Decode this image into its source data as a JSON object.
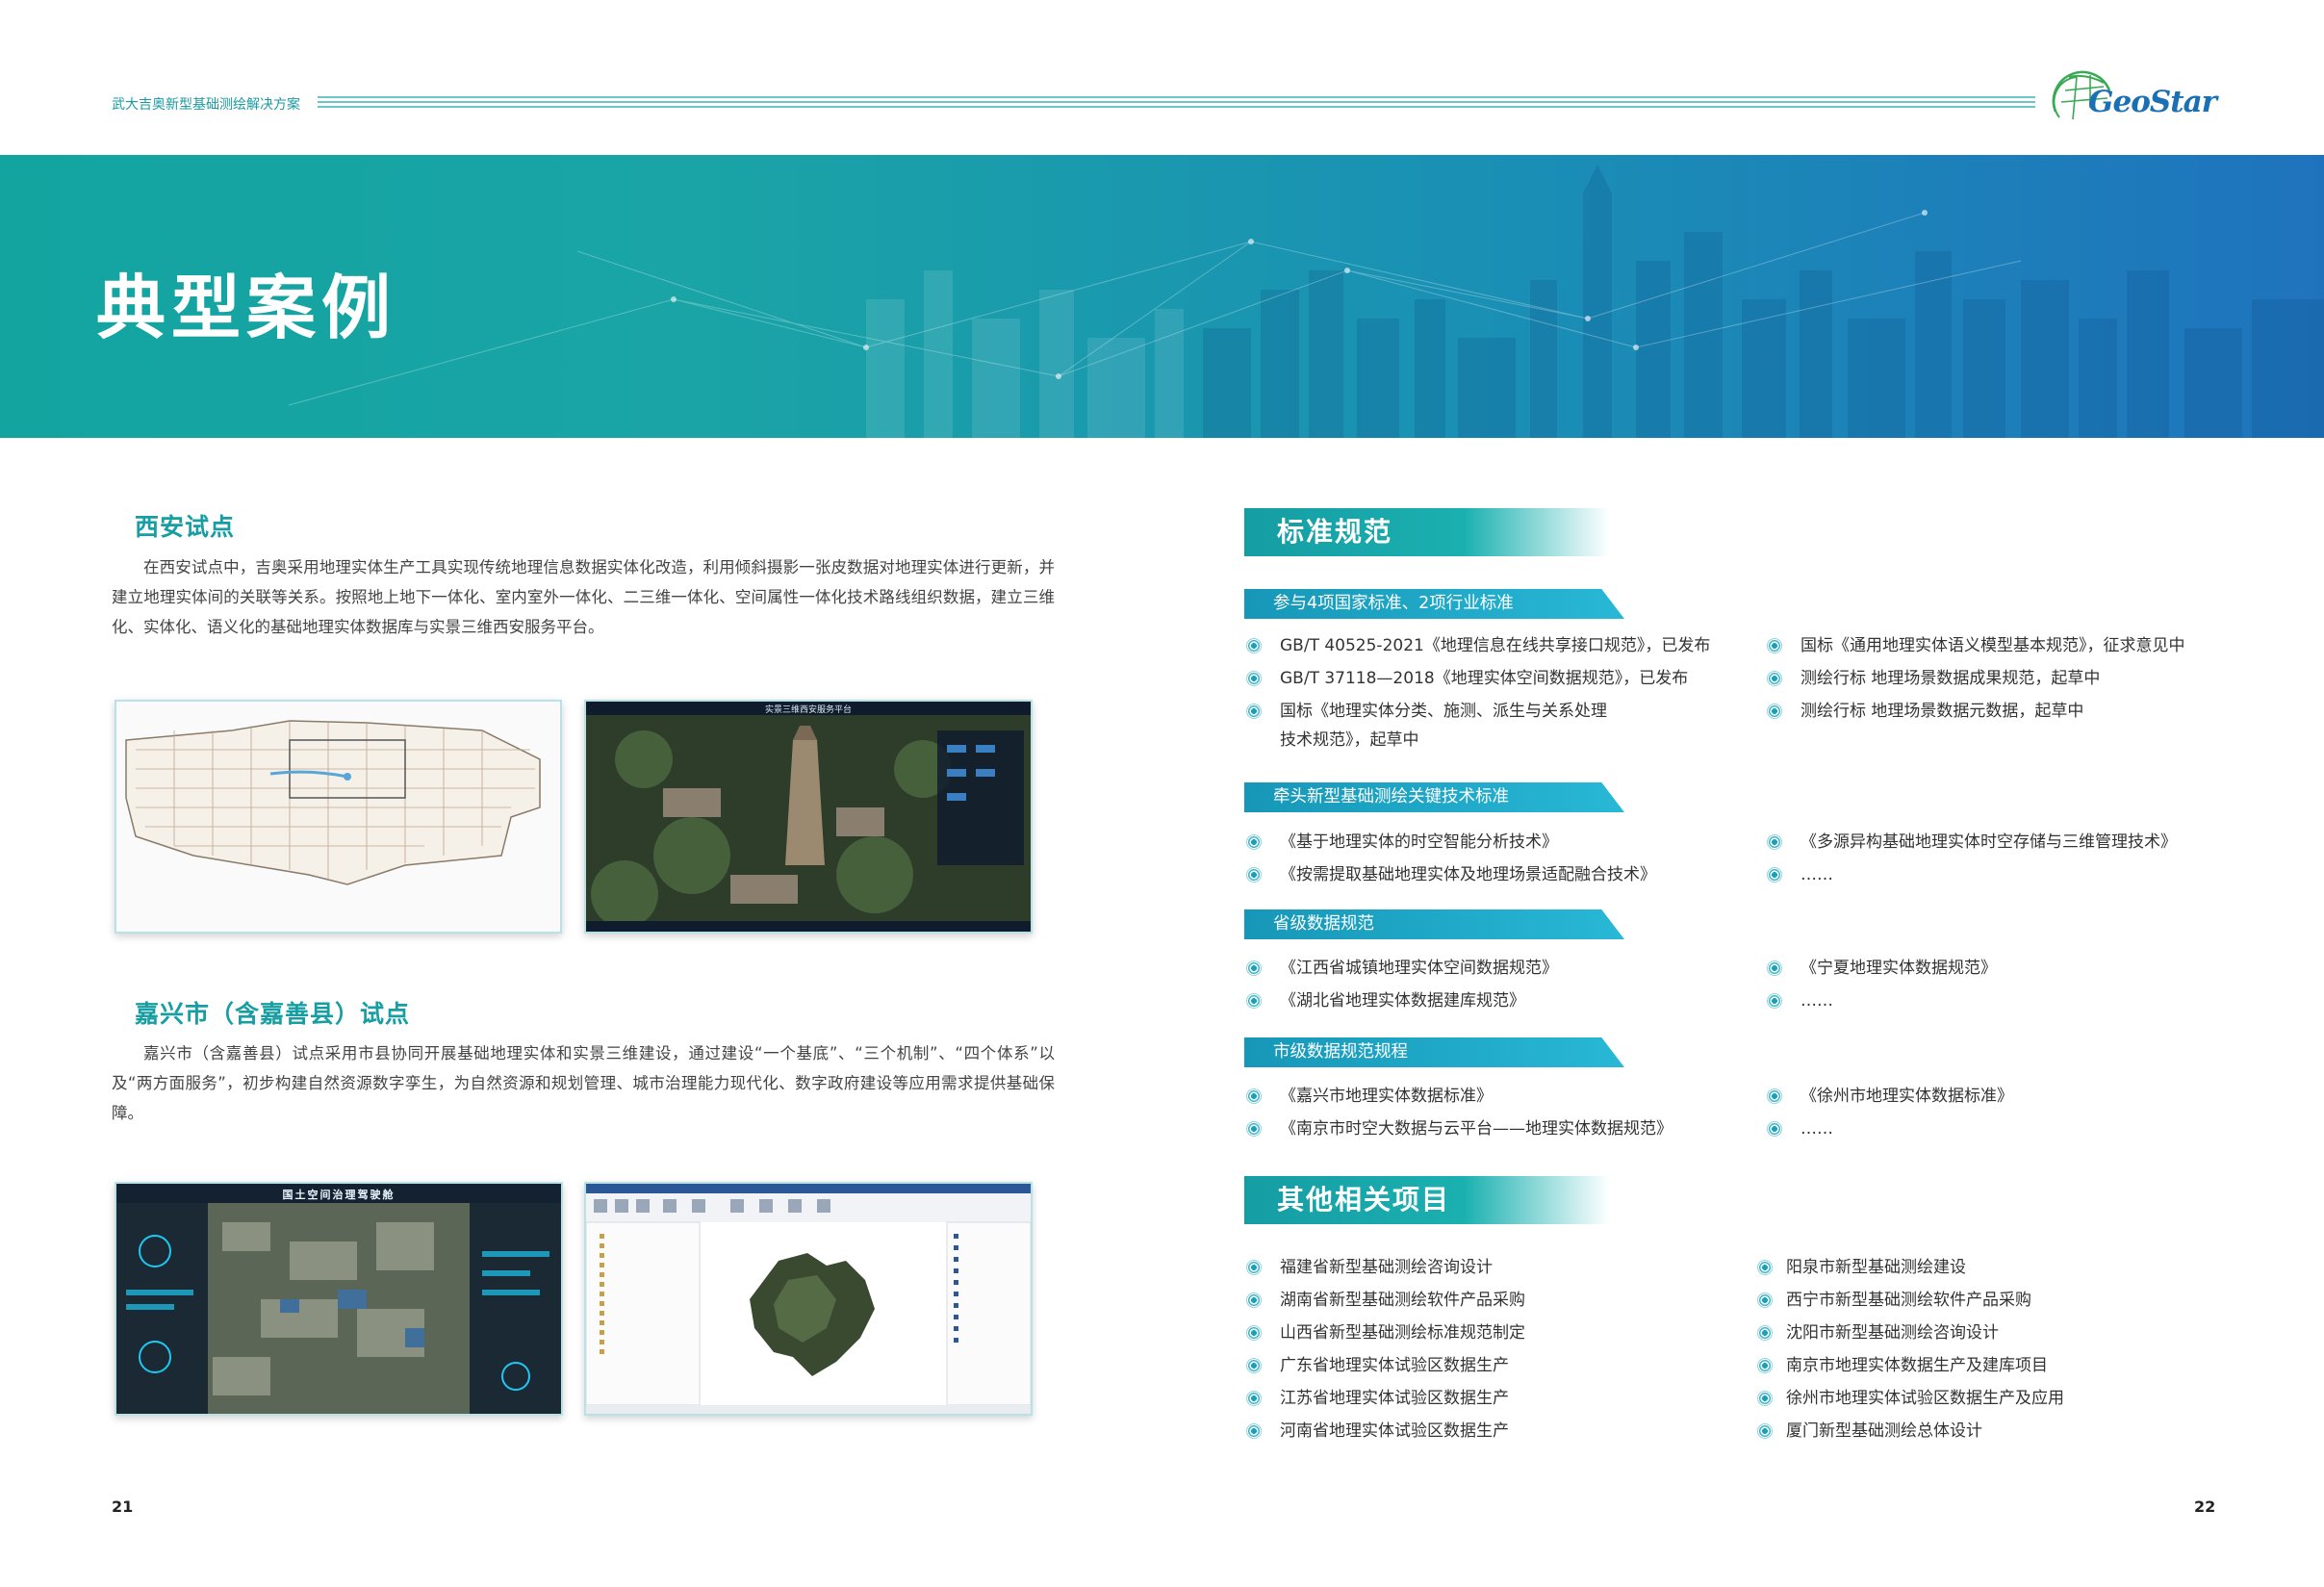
{
  "header": {
    "title": "武大吉奥新型基础测绘解决方案",
    "logo_text": "GeoStar"
  },
  "banner": {
    "title": "典型案例"
  },
  "xian": {
    "title": "西安试点",
    "text": "在西安试点中，吉奥采用地理实体生产工具实现传统地理信息数据实体化改造，利用倾斜摄影一张皮数据对地理实体进行更新，并建立地理实体间的关联等关系。按照地上地下一体化、室内室外一体化、二三维一体化、空间属性一体化技术路线组织数据，建立三维化、实体化、语义化的基础地理实体数据库与实景三维西安服务平台。",
    "screenshot2_title": "实景三维西安服务平台"
  },
  "jiaxing": {
    "title": "嘉兴市（含嘉善县）试点",
    "text": "嘉兴市（含嘉善县）试点采用市县协同开展基础地理实体和实景三维建设，通过建设“一个基底”、“三个机制”、“四个体系”以及“两方面服务”，初步构建自然资源数字孪生，为自然资源和规划管理、城市治理能力现代化、数字政府建设等应用需求提供基础保障。",
    "screenshot1_title": "国土空间治理驾驶舱"
  },
  "standards": {
    "heading": "标准规范",
    "groups": [
      {
        "tag": "参与4项国家标准、2项行业标准",
        "left": [
          "GB/T 40525-2021《地理信息在线共享接口规范》，已发布",
          "GB/T 37118—2018《地理实体空间数据规范》，已发布",
          "国标《地理实体分类、施测、派生与关系处理",
          "技术规范》，起草中"
        ],
        "right": [
          "国标《通用地理实体语义模型基本规范》，征求意见中",
          "测绘行标 地理场景数据成果规范，起草中",
          "测绘行标 地理场景数据元数据，起草中"
        ]
      },
      {
        "tag": "牵头新型基础测绘关键技术标准",
        "left": [
          "《基于地理实体的时空智能分析技术》",
          "《按需提取基础地理实体及地理场景适配融合技术》"
        ],
        "right": [
          "《多源异构基础地理实体时空存储与三维管理技术》",
          "……"
        ]
      },
      {
        "tag": "省级数据规范",
        "left": [
          "《江西省城镇地理实体空间数据规范》",
          "《湖北省地理实体数据建库规范》"
        ],
        "right": [
          "《宁夏地理实体数据规范》",
          "……"
        ]
      },
      {
        "tag": "市级数据规范规程",
        "left": [
          "《嘉兴市地理实体数据标准》",
          "《南京市时空大数据与云平台——地理实体数据规范》"
        ],
        "right": [
          "《徐州市地理实体数据标准》",
          "……"
        ]
      }
    ]
  },
  "projects": {
    "heading": "其他相关项目",
    "left": [
      "福建省新型基础测绘咨询设计",
      "湖南省新型基础测绘软件产品采购",
      "山西省新型基础测绘标准规范制定",
      "广东省地理实体试验区数据生产",
      "江苏省地理实体试验区数据生产",
      "河南省地理实体试验区数据生产"
    ],
    "right": [
      "阳泉市新型基础测绘建设",
      "西宁市新型基础测绘软件产品采购",
      "沈阳市新型基础测绘咨询设计",
      "南京市地理实体数据生产及建库项目",
      "徐州市地理实体试验区数据生产及应用",
      "厦门新型基础测绘总体设计"
    ]
  },
  "pages": {
    "left": "21",
    "right": "22"
  },
  "colors": {
    "accent": "#169ea2",
    "tag": "#1797b8",
    "banner_start": "#13a4a0",
    "banner_end": "#1f73bd"
  }
}
